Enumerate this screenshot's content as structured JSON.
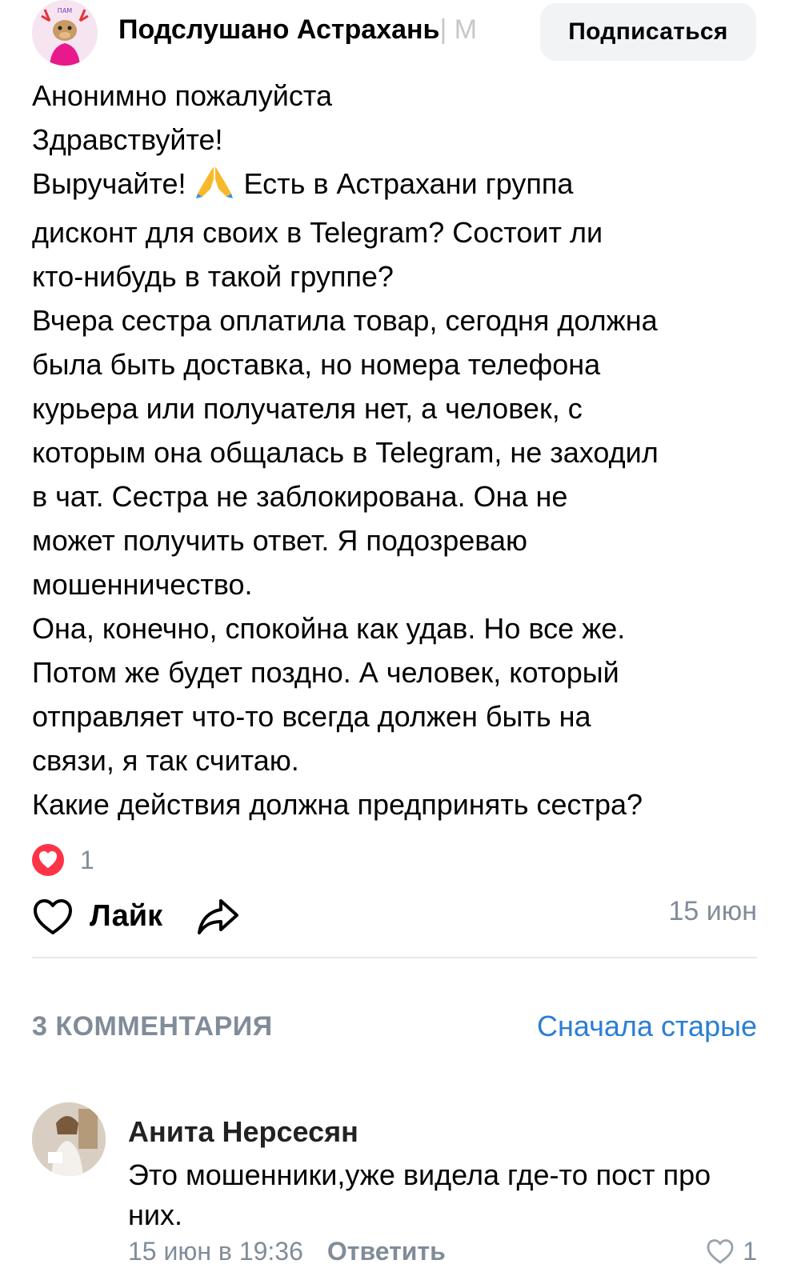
{
  "header": {
    "group_name": "Подслушано Астрахань",
    "group_name_overflow": "| М",
    "subscribe_label": "Подписаться",
    "avatar_text": "ПАМ"
  },
  "post": {
    "lines": [
      "Анонимно пожалуйста",
      "Здравствуйте!",
      "Выручайте!",
      "Есть в Астрахани группа",
      "дисконт для своих  в Telegram?  Состоит ли",
      "кто-нибудь в такой группе?",
      "Вчера сестра оплатила товар, сегодня должна",
      "была быть доставка, но номера телефона",
      "курьера или получателя нет, а человек, с",
      "которым она общалась в Telegram, не заходил",
      "в чат.  Сестра не заблокирована. Она не",
      "может получить ответ.  Я подозреваю",
      "мошенничество.",
      "Она, конечно, спокойна как удав. Но все же.",
      "Потом же будет поздно. А человек, который",
      "отправляет что-то всегда должен быть на",
      "связи, я так считаю.",
      "Какие действия должна предпринять сестра?"
    ],
    "emoji": "folded-hands",
    "reaction_count": "1",
    "like_label": "Лайк",
    "date": "15 июн"
  },
  "comments": {
    "count_label": "3 КОММЕНТАРИЯ",
    "sort_label": "Сначала старые",
    "items": [
      {
        "author": "Анита Нерсесян",
        "text": "Это мошенники,уже видела где-то пост про них.",
        "time": "15 июн в 19:36",
        "reply_label": "Ответить",
        "likes": "1"
      }
    ]
  },
  "colors": {
    "accent_link": "#2b7ed4",
    "secondary_text": "#818c99",
    "reaction_red": "#ff3347",
    "button_bg": "#f2f3f5"
  }
}
